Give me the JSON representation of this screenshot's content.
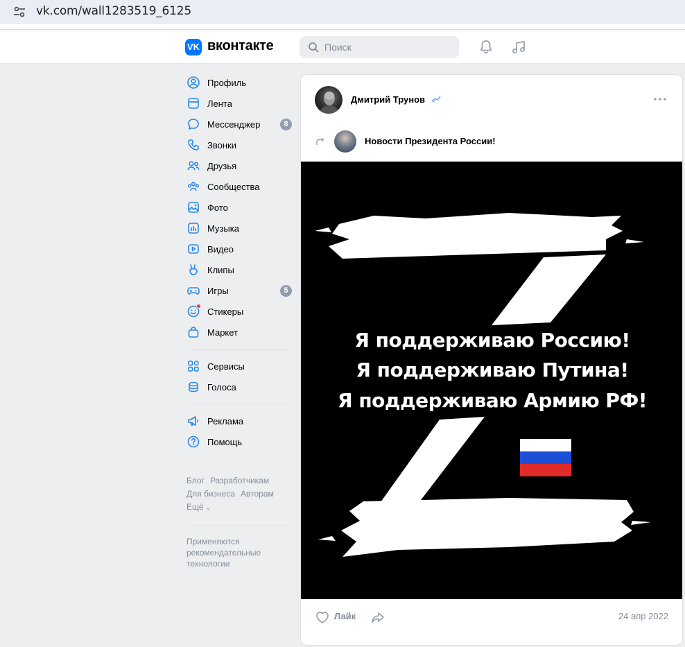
{
  "browser": {
    "url": "vk.com/wall1283519_6125"
  },
  "header": {
    "logo_mark": "VK",
    "logo_text": "вконтакте",
    "search_placeholder": "Поиск"
  },
  "sidebar": {
    "items": [
      {
        "label": "Профиль",
        "icon": "profile-icon"
      },
      {
        "label": "Лента",
        "icon": "feed-icon"
      },
      {
        "label": "Мессенджер",
        "icon": "messenger-icon",
        "badge": "8"
      },
      {
        "label": "Звонки",
        "icon": "phone-icon"
      },
      {
        "label": "Друзья",
        "icon": "friends-icon"
      },
      {
        "label": "Сообщества",
        "icon": "communities-icon"
      },
      {
        "label": "Фото",
        "icon": "photo-icon"
      },
      {
        "label": "Музыка",
        "icon": "music-icon"
      },
      {
        "label": "Видео",
        "icon": "video-icon"
      },
      {
        "label": "Клипы",
        "icon": "clips-icon"
      },
      {
        "label": "Игры",
        "icon": "games-icon",
        "badge": "5"
      },
      {
        "label": "Стикеры",
        "icon": "stickers-icon"
      },
      {
        "label": "Маркет",
        "icon": "market-icon"
      }
    ],
    "items2": [
      {
        "label": "Сервисы",
        "icon": "services-icon"
      },
      {
        "label": "Голоса",
        "icon": "votes-icon"
      }
    ],
    "items3": [
      {
        "label": "Реклама",
        "icon": "ads-icon"
      },
      {
        "label": "Помощь",
        "icon": "help-icon"
      }
    ],
    "footer": {
      "blog": "Блог",
      "devs": "Разработчикам",
      "business": "Для бизнеса",
      "authors": "Авторам",
      "more": "Ещё"
    },
    "recommend_note": "Применяются рекомендательные технологии"
  },
  "post": {
    "author": "Дмитрий Трунов",
    "source": "Новости Президента России!",
    "image_lines": [
      "Я поддерживаю Россию!",
      "Я поддерживаю Путина!",
      "Я поддерживаю Армию РФ!"
    ],
    "like_label": "Лайк",
    "date": "24 апр 2022"
  },
  "colors": {
    "accent": "#0077ff",
    "icon": "#2688eb",
    "muted": "#818c99",
    "background": "#edeef0"
  }
}
